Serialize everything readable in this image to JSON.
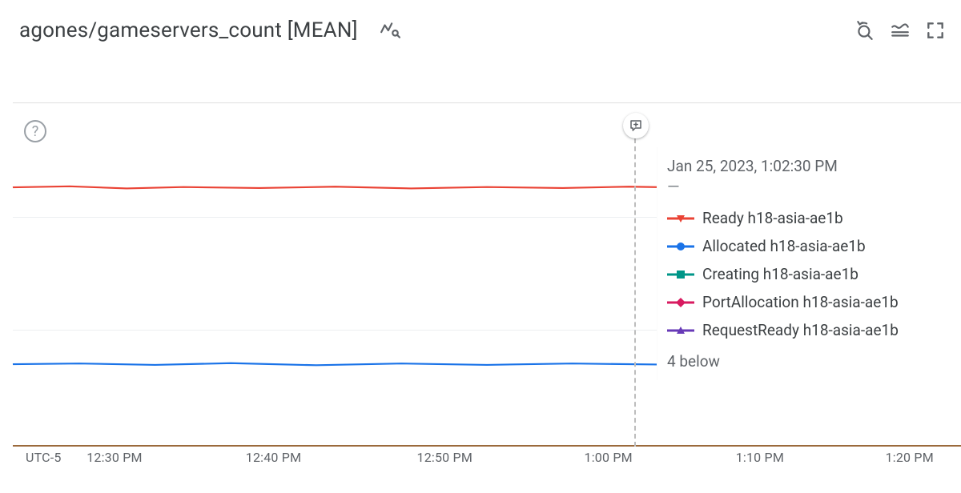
{
  "header": {
    "title": "agones/gameservers_count [MEAN]"
  },
  "chart_data": {
    "type": "line",
    "title": "agones/gameservers_count [MEAN]",
    "xlabel": "",
    "ylabel": "",
    "timezone": "UTC-5",
    "x_ticks": [
      "12:30 PM",
      "12:40 PM",
      "12:50 PM",
      "1:00 PM",
      "1:10 PM",
      "1:20 PM"
    ],
    "hover_time": "Jan 25, 2023, 1:02:30 PM",
    "ylim_approx": [
      0,
      100
    ],
    "series": [
      {
        "name": "Ready h18-asia-ae1b",
        "color": "#ea4335",
        "marker": "triangle-down",
        "approx_value_pct_of_range": 76
      },
      {
        "name": "Allocated h18-asia-ae1b",
        "color": "#1a73e8",
        "marker": "circle",
        "approx_value_pct_of_range": 24
      },
      {
        "name": "Creating h18-asia-ae1b",
        "color": "#009688",
        "marker": "square",
        "approx_value_pct_of_range": 0
      },
      {
        "name": "PortAllocation h18-asia-ae1b",
        "color": "#d81b60",
        "marker": "diamond",
        "approx_value_pct_of_range": 0
      },
      {
        "name": "RequestReady h18-asia-ae1b",
        "color": "#673ab7",
        "marker": "triangle-up",
        "approx_value_pct_of_range": 0
      }
    ],
    "more_below": "4 below"
  },
  "axis": {
    "timezone": "UTC-5",
    "ticks": [
      {
        "label": "12:30 PM",
        "pct": 9.5
      },
      {
        "label": "12:40 PM",
        "pct": 26.5
      },
      {
        "label": "12:50 PM",
        "pct": 44.8
      },
      {
        "label": "1:00 PM",
        "pct": 62.3
      },
      {
        "label": "1:10 PM",
        "pct": 78.5
      },
      {
        "label": "1:20 PM",
        "pct": 94.5
      }
    ]
  },
  "hover": {
    "x_pct": 65.5,
    "time": "Jan 25, 2023, 1:02:30 PM",
    "value_text": "—",
    "more": "4 below",
    "items": [
      {
        "label": "Ready h18-asia-ae1b",
        "color": "#ea4335",
        "marker": "triangle-down"
      },
      {
        "label": "Allocated h18-asia-ae1b",
        "color": "#1a73e8",
        "marker": "circle"
      },
      {
        "label": "Creating h18-asia-ae1b",
        "color": "#009688",
        "marker": "square"
      },
      {
        "label": "PortAllocation h18-asia-ae1b",
        "color": "#d81b60",
        "marker": "diamond"
      },
      {
        "label": "RequestReady h18-asia-ae1b",
        "color": "#673ab7",
        "marker": "triangle-up"
      }
    ]
  },
  "gridlines_pct_from_top": [
    33,
    66
  ]
}
